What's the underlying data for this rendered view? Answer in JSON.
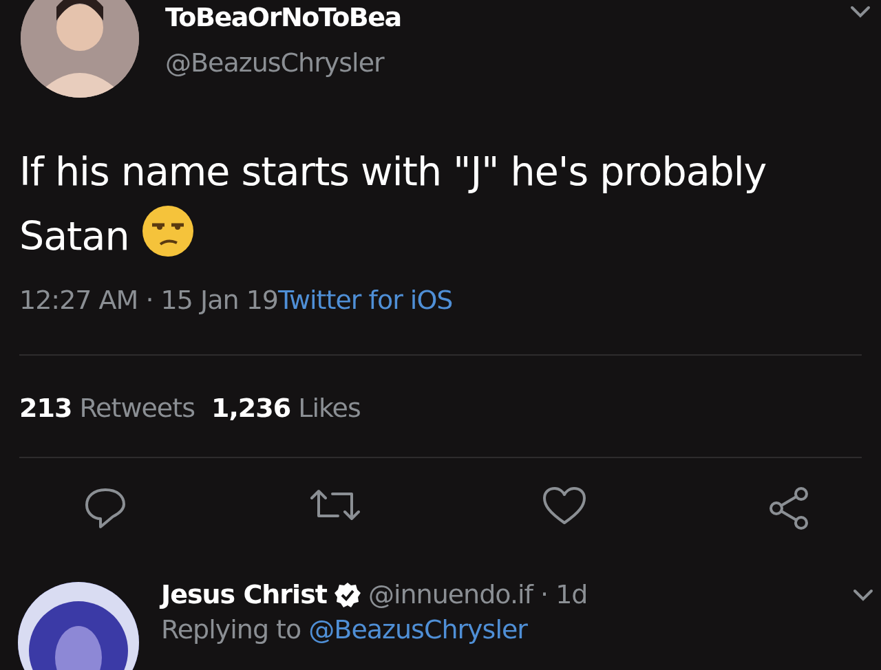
{
  "tweet": {
    "name": "ToBeaOrNoToBea",
    "handle": "@BeazusChrysler",
    "text": "If his name starts with \"J\" he's probably Satan",
    "time": "12:27 AM",
    "time_separator": "·",
    "date": "15 Jan 19",
    "source": "Twitter for iOS",
    "retweets": {
      "count": "213",
      "label": "Retweets"
    },
    "likes": {
      "count": "1,236",
      "label": "Likes"
    }
  },
  "reply": {
    "name": "Jesus Christ",
    "verified": true,
    "handle": "@innuendo.if",
    "separator": "·",
    "age": "1d",
    "replying_label": "Replying to",
    "replying_to": "@BeazusChrysler"
  }
}
